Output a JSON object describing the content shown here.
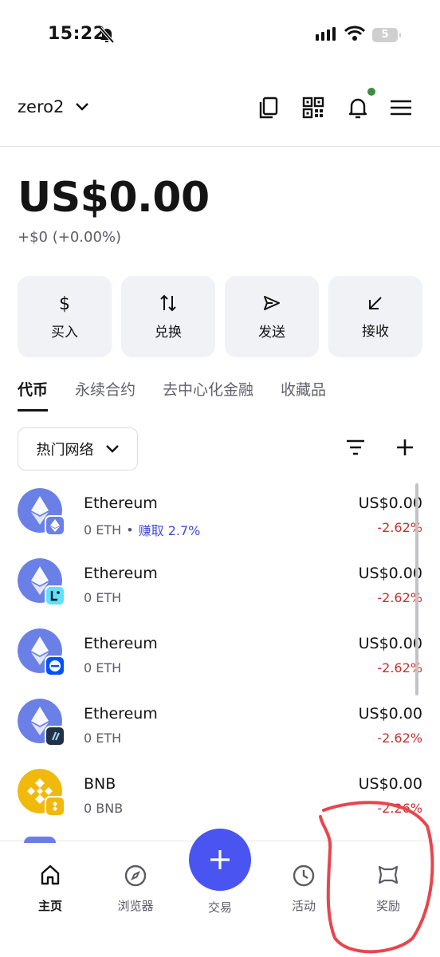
{
  "status_bar": {
    "time": "15:22",
    "battery": "5"
  },
  "header": {
    "account_name": "zero2",
    "icons": [
      "copy-icon",
      "qr-code-icon",
      "bell-icon",
      "menu-icon"
    ]
  },
  "balance": {
    "total": "US$0.00",
    "change": "+$0 (+0.00%)"
  },
  "actions": [
    {
      "label": "买入",
      "icon": "dollar-icon"
    },
    {
      "label": "兑换",
      "icon": "swap-icon"
    },
    {
      "label": "发送",
      "icon": "send-icon"
    },
    {
      "label": "接收",
      "icon": "receive-icon"
    }
  ],
  "tabs": [
    {
      "label": "代币",
      "active": true
    },
    {
      "label": "永续合约",
      "active": false
    },
    {
      "label": "去中心化金融",
      "active": false
    },
    {
      "label": "收藏品",
      "active": false
    }
  ],
  "network_filter": {
    "label": "热门网络"
  },
  "tokens": [
    {
      "name": "Ethereum",
      "amount": "0 ETH",
      "earn": "赚取 2.7%",
      "value": "US$0.00",
      "change": "-2.62%",
      "network": "ethereum"
    },
    {
      "name": "Ethereum",
      "amount": "0 ETH",
      "earn": "",
      "value": "US$0.00",
      "change": "-2.62%",
      "network": "linea"
    },
    {
      "name": "Ethereum",
      "amount": "0 ETH",
      "earn": "",
      "value": "US$0.00",
      "change": "-2.62%",
      "network": "base"
    },
    {
      "name": "Ethereum",
      "amount": "0 ETH",
      "earn": "",
      "value": "US$0.00",
      "change": "-2.62%",
      "network": "arbitrum"
    },
    {
      "name": "BNB",
      "amount": "0 BNB",
      "earn": "",
      "value": "US$0.00",
      "change": "-2.26%",
      "network": "bnb"
    }
  ],
  "bottom_nav": [
    {
      "label": "主页",
      "icon": "home-icon",
      "active": true
    },
    {
      "label": "浏览器",
      "icon": "compass-icon",
      "active": false
    },
    {
      "label": "交易",
      "icon": "plus-icon",
      "active": false
    },
    {
      "label": "活动",
      "icon": "clock-icon",
      "active": false
    },
    {
      "label": "奖励",
      "icon": "rewards-icon",
      "active": false
    }
  ],
  "colors": {
    "accent": "#4a54f1",
    "negative": "#c5322f",
    "earn": "#3f4ed8",
    "eth": "#6a80e6",
    "bnb": "#f0b90b",
    "annotation": "#e8454c"
  }
}
